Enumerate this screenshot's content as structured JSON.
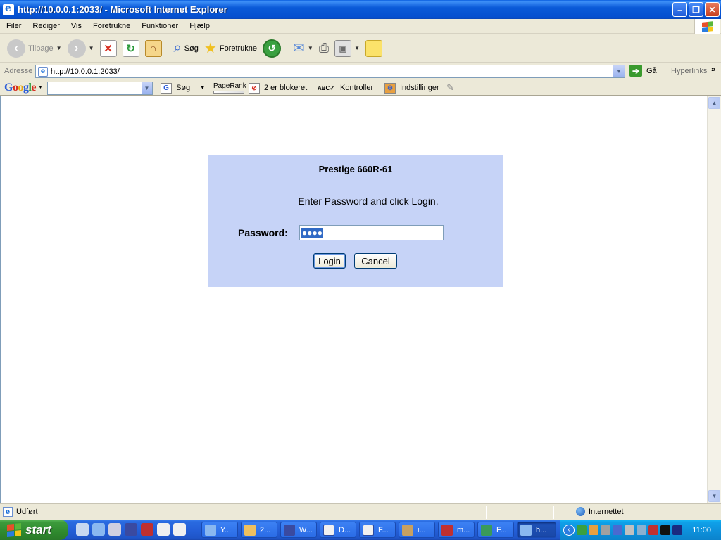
{
  "window": {
    "title": "http://10.0.0.1:2033/ - Microsoft Internet Explorer",
    "minimize_glyph": "–",
    "maximize_glyph": "❐",
    "close_glyph": "✕"
  },
  "menubar": {
    "items": [
      "Filer",
      "Rediger",
      "Vis",
      "Foretrukne",
      "Funktioner",
      "Hjælp"
    ]
  },
  "toolbar": {
    "back_label": "Tilbage",
    "search_label": "Søg",
    "favorites_label": "Foretrukne"
  },
  "addressbar": {
    "label": "Adresse",
    "url": "http://10.0.0.1:2033/",
    "go_label": "Gå",
    "links_label": "Hyperlinks"
  },
  "googlebar": {
    "search_label": "Søg",
    "pagerank_label": "PageRank",
    "blocked_label": "2 er blokeret",
    "check_label": "Kontroller",
    "settings_label": "Indstillinger"
  },
  "login": {
    "title": "Prestige 660R-61",
    "instruction": "Enter Password and click Login.",
    "password_label": "Password:",
    "password_masked": "●●●●",
    "login_button": "Login",
    "cancel_button": "Cancel"
  },
  "statusbar": {
    "status": "Udført",
    "zone": "Internettet"
  },
  "taskbar": {
    "start_label": "start",
    "tasks": [
      "Y...",
      "2...",
      "W...",
      "D...",
      "F...",
      "i...",
      "m...",
      "F...",
      "h..."
    ],
    "clock": "11:00"
  },
  "colors": {
    "login_panel": "#c6d3f7",
    "titlebar": "#0a5ad8",
    "taskbar": "#245fd8",
    "start_button": "#3c9a3b"
  }
}
